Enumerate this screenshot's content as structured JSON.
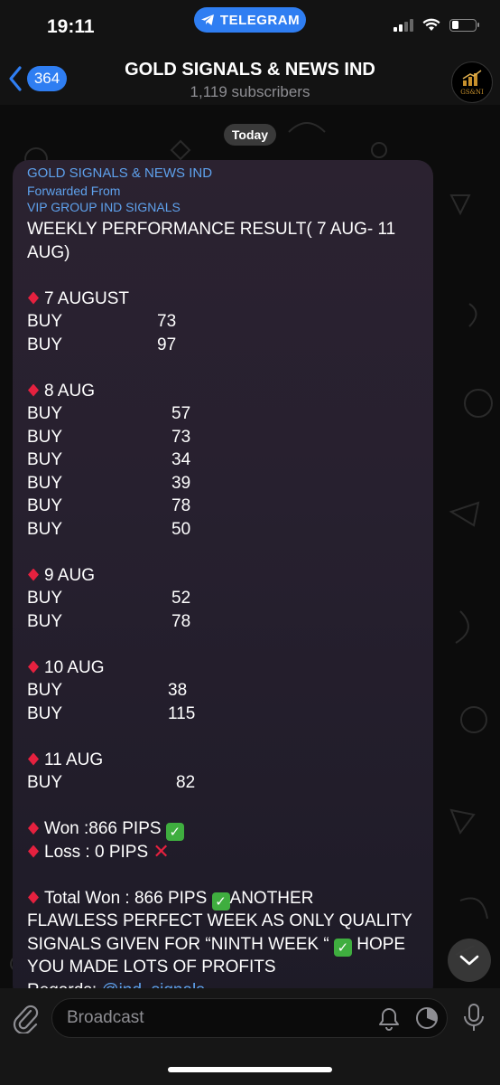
{
  "status": {
    "time": "19:11",
    "app_pill": "TELEGRAM"
  },
  "header": {
    "back_count": "364",
    "title": "GOLD SIGNALS & NEWS IND",
    "subtitle": "1,119 subscribers"
  },
  "chat": {
    "date_label": "Today",
    "message": {
      "author": "GOLD SIGNALS & NEWS IND",
      "forwarded_label": "Forwarded From",
      "forwarded_source": "VIP GROUP IND SIGNALS",
      "heading_1": "WEEKLY PERFORMANCE RESULT( 7 AUG- 11",
      "heading_2": "AUG)",
      "days": [
        {
          "label": "7 AUGUST",
          "rows": [
            {
              "action": "BUY",
              "value": "73"
            },
            {
              "action": "BUY",
              "value": "97"
            }
          ]
        },
        {
          "label": "8 AUG",
          "rows": [
            {
              "action": "BUY",
              "value": "57"
            },
            {
              "action": "BUY",
              "value": "73"
            },
            {
              "action": "BUY",
              "value": "34"
            },
            {
              "action": "BUY",
              "value": "39"
            },
            {
              "action": "BUY",
              "value": "78"
            },
            {
              "action": "BUY",
              "value": "50"
            }
          ]
        },
        {
          "label": "9 AUG",
          "rows": [
            {
              "action": "BUY",
              "value": "52"
            },
            {
              "action": "BUY",
              "value": "78"
            }
          ]
        },
        {
          "label": "10 AUG",
          "rows": [
            {
              "action": "BUY",
              "value": "38"
            },
            {
              "action": "BUY",
              "value": "115"
            }
          ]
        },
        {
          "label": "11 AUG",
          "rows": [
            {
              "action": "BUY",
              "value": "82"
            }
          ]
        }
      ],
      "won_line": "Won :866 PIPS",
      "loss_line": "Loss : 0 PIPS",
      "total_prefix": "Total Won : 866 PIPS",
      "total_rest_1": "ANOTHER",
      "total_line_2": "FLAWLESS PERFECT WEEK AS ONLY QUALITY",
      "total_line_3a": "SIGNALS GIVEN FOR “NINTH WEEK “",
      "total_line_3b": "HOPE",
      "total_line_4": "YOU MADE LOTS OF PROFITS",
      "regards_label": "Regards:",
      "regards_link": "@ind_signals"
    }
  },
  "composer": {
    "placeholder": "Broadcast"
  },
  "icons": {
    "back": "chevron-left-icon",
    "attach": "paperclip-icon",
    "bell": "bell-icon",
    "timer": "timer-icon",
    "mic": "microphone-icon",
    "scroll": "chevron-down-icon"
  },
  "colors": {
    "accent": "#2f7ef2",
    "link": "#5ea1ec",
    "diamond": "#e5213f",
    "check": "#3fae3f"
  }
}
